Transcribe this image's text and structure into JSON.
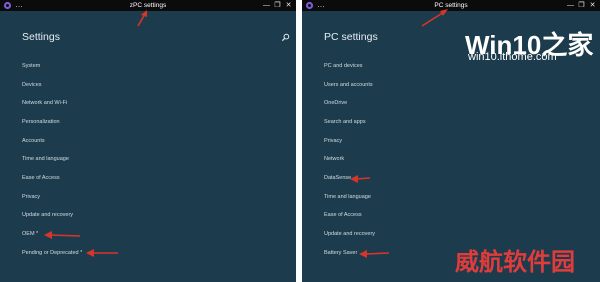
{
  "left": {
    "title_bar": "zPC settings",
    "page_title": "Settings",
    "items": [
      "System",
      "Devices",
      "Network and Wi-Fi",
      "Personalization",
      "Accounts",
      "Time and language",
      "Ease of Access",
      "Privacy",
      "Update and recovery",
      "OEM *",
      "Pending or Deprecated *"
    ]
  },
  "right": {
    "title_bar": "PC settings",
    "page_title": "PC settings",
    "items": [
      "PC and devices",
      "Users and accounts",
      "OneDrive",
      "Search and apps",
      "Privacy",
      "Network",
      "DataSense",
      "Time and language",
      "Ease of Access",
      "Update and recovery",
      "Battery Saver"
    ]
  },
  "window_controls": {
    "minimize": "—",
    "restore": "❐",
    "close": "✕"
  },
  "menu_glyph": "…",
  "watermark": {
    "title": "Win10之家",
    "url": "win10.ithome.com",
    "stamp": "威航软件园"
  },
  "colors": {
    "window_bg": "#1c3b4c",
    "titlebar_bg": "#0b0b0b",
    "arrow": "#d9342b",
    "stamp": "#e03c3c"
  },
  "icons": {
    "app": "gear-icon",
    "search": "search-icon"
  }
}
